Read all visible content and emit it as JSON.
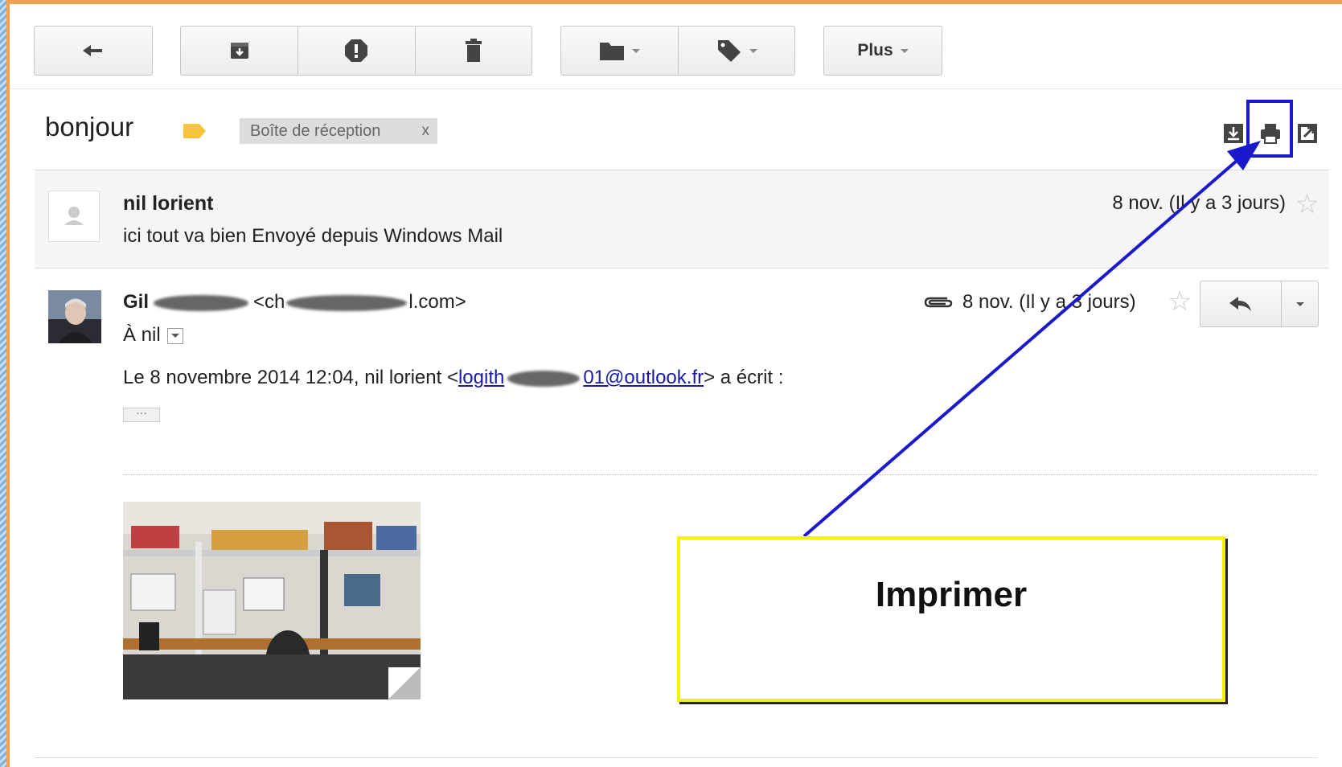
{
  "toolbar": {
    "more_label": "Plus",
    "icons": [
      "reply-icon",
      "archive-icon",
      "spam-icon",
      "trash-icon",
      "folder-icon",
      "label-icon"
    ]
  },
  "thread": {
    "subject": "bonjour",
    "label_chip": "Boîte de réception",
    "label_chip_close": "x",
    "top_icons": [
      "download-icon",
      "print-icon",
      "new-window-icon"
    ]
  },
  "message1": {
    "sender": "nil lorient",
    "snippet": "ici tout va bien Envoyé depuis Windows Mail",
    "date": "8 nov. (Il y a 3 jours)"
  },
  "message2": {
    "sender_visible": "Gil",
    "sender_email_start": "<ch",
    "sender_email_end": "l.com>",
    "to_label": "À nil",
    "date": "8 nov. (Il y a 3 jours)",
    "quote_prefix": "Le 8 novembre 2014 12:04, nil lorient <",
    "quote_email_start": "logith",
    "quote_email_end": "01@outlook.fr",
    "quote_suffix": "> a écrit :",
    "ellipsis": "···"
  },
  "annotation": {
    "callout_text": "Imprimer",
    "highlight_color": "#1a1acc",
    "callout_border_color": "#f4f400"
  }
}
